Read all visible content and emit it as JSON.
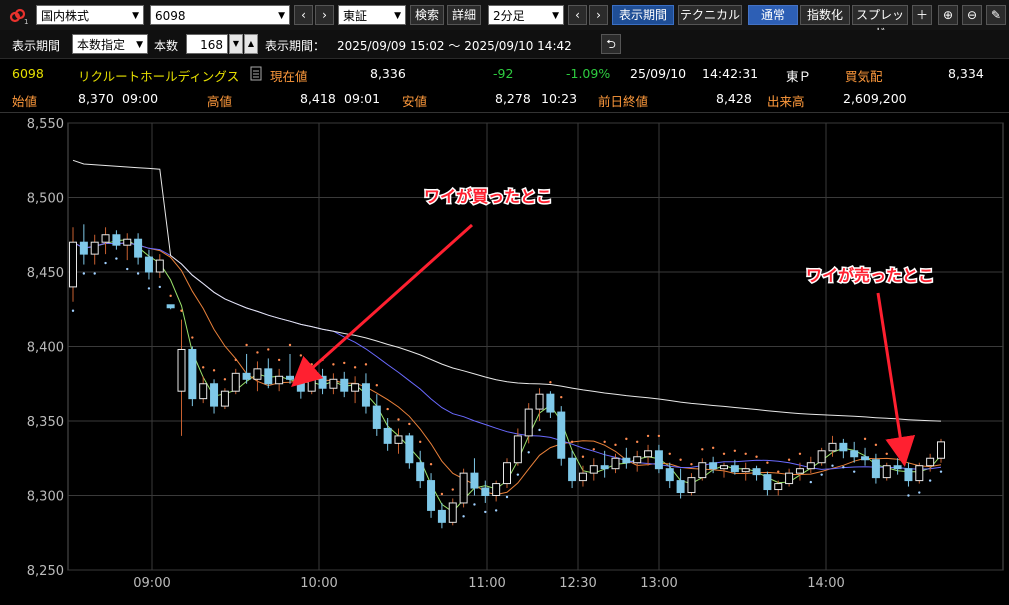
{
  "toolbar": {
    "market_select": "国内株式",
    "code_input": "6098",
    "exchange_select": "東証",
    "search_label": "検索",
    "detail_label": "詳細",
    "interval_select": "2分足",
    "display_period_label": "表示期間",
    "technical_label": "テクニカル",
    "normal_label": "通常",
    "index_label": "指数化",
    "spread_label": "スプレッド",
    "icons": [
      "link-icon",
      "chevron-left-icon",
      "chevron-right-icon",
      "plus-icon",
      "zoom-in-icon",
      "zoom-out-icon",
      "pencil-icon"
    ]
  },
  "period_bar": {
    "display_period_label": "表示期間",
    "mode_select": "本数指定",
    "count_label": "本数",
    "count_value": "168",
    "range_label": "表示期間：",
    "range_value": "2025/09/09 15:02 〜 2025/09/10 14:42"
  },
  "quote": {
    "code": "6098",
    "name": "リクルートホールディングス",
    "current_label": "現在値",
    "current_value": "8,336",
    "change": "-92",
    "change_pct": "-1.09%",
    "date": "25/09/10",
    "time": "14:42:31",
    "market": "東Ｐ",
    "bid_label": "買気配",
    "bid_value": "8,334",
    "open_label": "始値",
    "open_value": "8,370",
    "open_time": "09:00",
    "high_label": "高値",
    "high_value": "8,418",
    "high_time": "09:01",
    "low_label": "安値",
    "low_value": "8,278",
    "low_time": "10:23",
    "prev_close_label": "前日終値",
    "prev_close_value": "8,428",
    "volume_label": "出来高",
    "volume_value": "2,609,200"
  },
  "colors": {
    "up": "#e8e8e8",
    "down": "#7fc8e8",
    "neg": "#2ecc40",
    "name": "#e6e000",
    "label": "#ff9a3c",
    "annot": "#ff2030"
  },
  "annotations": {
    "buy": "ワイが買ったとこ",
    "sell": "ワイが売ったとこ"
  },
  "chart_data": {
    "type": "candlestick",
    "y_ticks": [
      "8,550",
      "8,500",
      "8,450",
      "8,400",
      "8,350",
      "8,300",
      "8,250"
    ],
    "x_ticks": [
      "09:00",
      "10:00",
      "11:00",
      "12:30",
      "13:00",
      "14:00"
    ],
    "ylim": [
      8250,
      8550
    ],
    "grid": true,
    "candles": [
      [
        8440,
        8480,
        8430,
        8470
      ],
      [
        8470,
        8482,
        8455,
        8462
      ],
      [
        8462,
        8475,
        8455,
        8470
      ],
      [
        8470,
        8480,
        8462,
        8475
      ],
      [
        8475,
        8478,
        8465,
        8468
      ],
      [
        8468,
        8476,
        8458,
        8472
      ],
      [
        8472,
        8476,
        8455,
        8460
      ],
      [
        8460,
        8465,
        8445,
        8450
      ],
      [
        8450,
        8462,
        8446,
        8458
      ],
      [
        8428,
        8428,
        8425,
        8426
      ],
      [
        8370,
        8418,
        8340,
        8398
      ],
      [
        8398,
        8400,
        8360,
        8365
      ],
      [
        8365,
        8380,
        8362,
        8375
      ],
      [
        8375,
        8378,
        8355,
        8360
      ],
      [
        8360,
        8372,
        8358,
        8370
      ],
      [
        8370,
        8385,
        8368,
        8382
      ],
      [
        8382,
        8395,
        8375,
        8378
      ],
      [
        8378,
        8390,
        8370,
        8385
      ],
      [
        8385,
        8392,
        8372,
        8375
      ],
      [
        8375,
        8385,
        8370,
        8380
      ],
      [
        8380,
        8395,
        8375,
        8378
      ],
      [
        8378,
        8388,
        8365,
        8370
      ],
      [
        8370,
        8382,
        8368,
        8380
      ],
      [
        8380,
        8385,
        8368,
        8372
      ],
      [
        8372,
        8382,
        8368,
        8378
      ],
      [
        8378,
        8383,
        8366,
        8370
      ],
      [
        8370,
        8380,
        8362,
        8375
      ],
      [
        8375,
        8382,
        8355,
        8360
      ],
      [
        8360,
        8368,
        8340,
        8345
      ],
      [
        8345,
        8352,
        8330,
        8335
      ],
      [
        8335,
        8345,
        8328,
        8340
      ],
      [
        8340,
        8342,
        8318,
        8322
      ],
      [
        8322,
        8330,
        8305,
        8310
      ],
      [
        8310,
        8315,
        8285,
        8290
      ],
      [
        8290,
        8295,
        8278,
        8282
      ],
      [
        8282,
        8298,
        8280,
        8295
      ],
      [
        8295,
        8318,
        8292,
        8315
      ],
      [
        8315,
        8325,
        8300,
        8305
      ],
      [
        8305,
        8310,
        8295,
        8300
      ],
      [
        8300,
        8310,
        8296,
        8308
      ],
      [
        8308,
        8325,
        8305,
        8322
      ],
      [
        8322,
        8345,
        8320,
        8340
      ],
      [
        8340,
        8362,
        8335,
        8358
      ],
      [
        8358,
        8372,
        8350,
        8368
      ],
      [
        8368,
        8370,
        8352,
        8356
      ],
      [
        8356,
        8360,
        8320,
        8325
      ],
      [
        8325,
        8330,
        8305,
        8310
      ],
      [
        8310,
        8320,
        8306,
        8315
      ],
      [
        8315,
        8325,
        8310,
        8320
      ],
      [
        8320,
        8330,
        8312,
        8318
      ],
      [
        8318,
        8328,
        8315,
        8325
      ],
      [
        8325,
        8332,
        8318,
        8322
      ],
      [
        8322,
        8330,
        8316,
        8326
      ],
      [
        8326,
        8334,
        8320,
        8330
      ],
      [
        8330,
        8334,
        8315,
        8318
      ],
      [
        8318,
        8322,
        8305,
        8310
      ],
      [
        8310,
        8318,
        8298,
        8302
      ],
      [
        8302,
        8315,
        8300,
        8312
      ],
      [
        8312,
        8325,
        8310,
        8322
      ],
      [
        8322,
        8326,
        8315,
        8318
      ],
      [
        8318,
        8322,
        8312,
        8320
      ],
      [
        8320,
        8324,
        8314,
        8316
      ],
      [
        8316,
        8322,
        8310,
        8318
      ],
      [
        8318,
        8320,
        8310,
        8314
      ],
      [
        8314,
        8316,
        8300,
        8304
      ],
      [
        8304,
        8310,
        8300,
        8308
      ],
      [
        8308,
        8318,
        8306,
        8315
      ],
      [
        8315,
        8322,
        8310,
        8318
      ],
      [
        8318,
        8326,
        8315,
        8322
      ],
      [
        8322,
        8332,
        8320,
        8330
      ],
      [
        8330,
        8340,
        8326,
        8335
      ],
      [
        8335,
        8338,
        8325,
        8330
      ],
      [
        8330,
        8336,
        8322,
        8326
      ],
      [
        8326,
        8332,
        8320,
        8324
      ],
      [
        8324,
        8328,
        8308,
        8312
      ],
      [
        8312,
        8322,
        8310,
        8320
      ],
      [
        8320,
        8325,
        8314,
        8318
      ],
      [
        8318,
        8322,
        8306,
        8310
      ],
      [
        8310,
        8322,
        8308,
        8320
      ],
      [
        8320,
        8328,
        8316,
        8325
      ],
      [
        8325,
        8338,
        8322,
        8336
      ]
    ]
  }
}
